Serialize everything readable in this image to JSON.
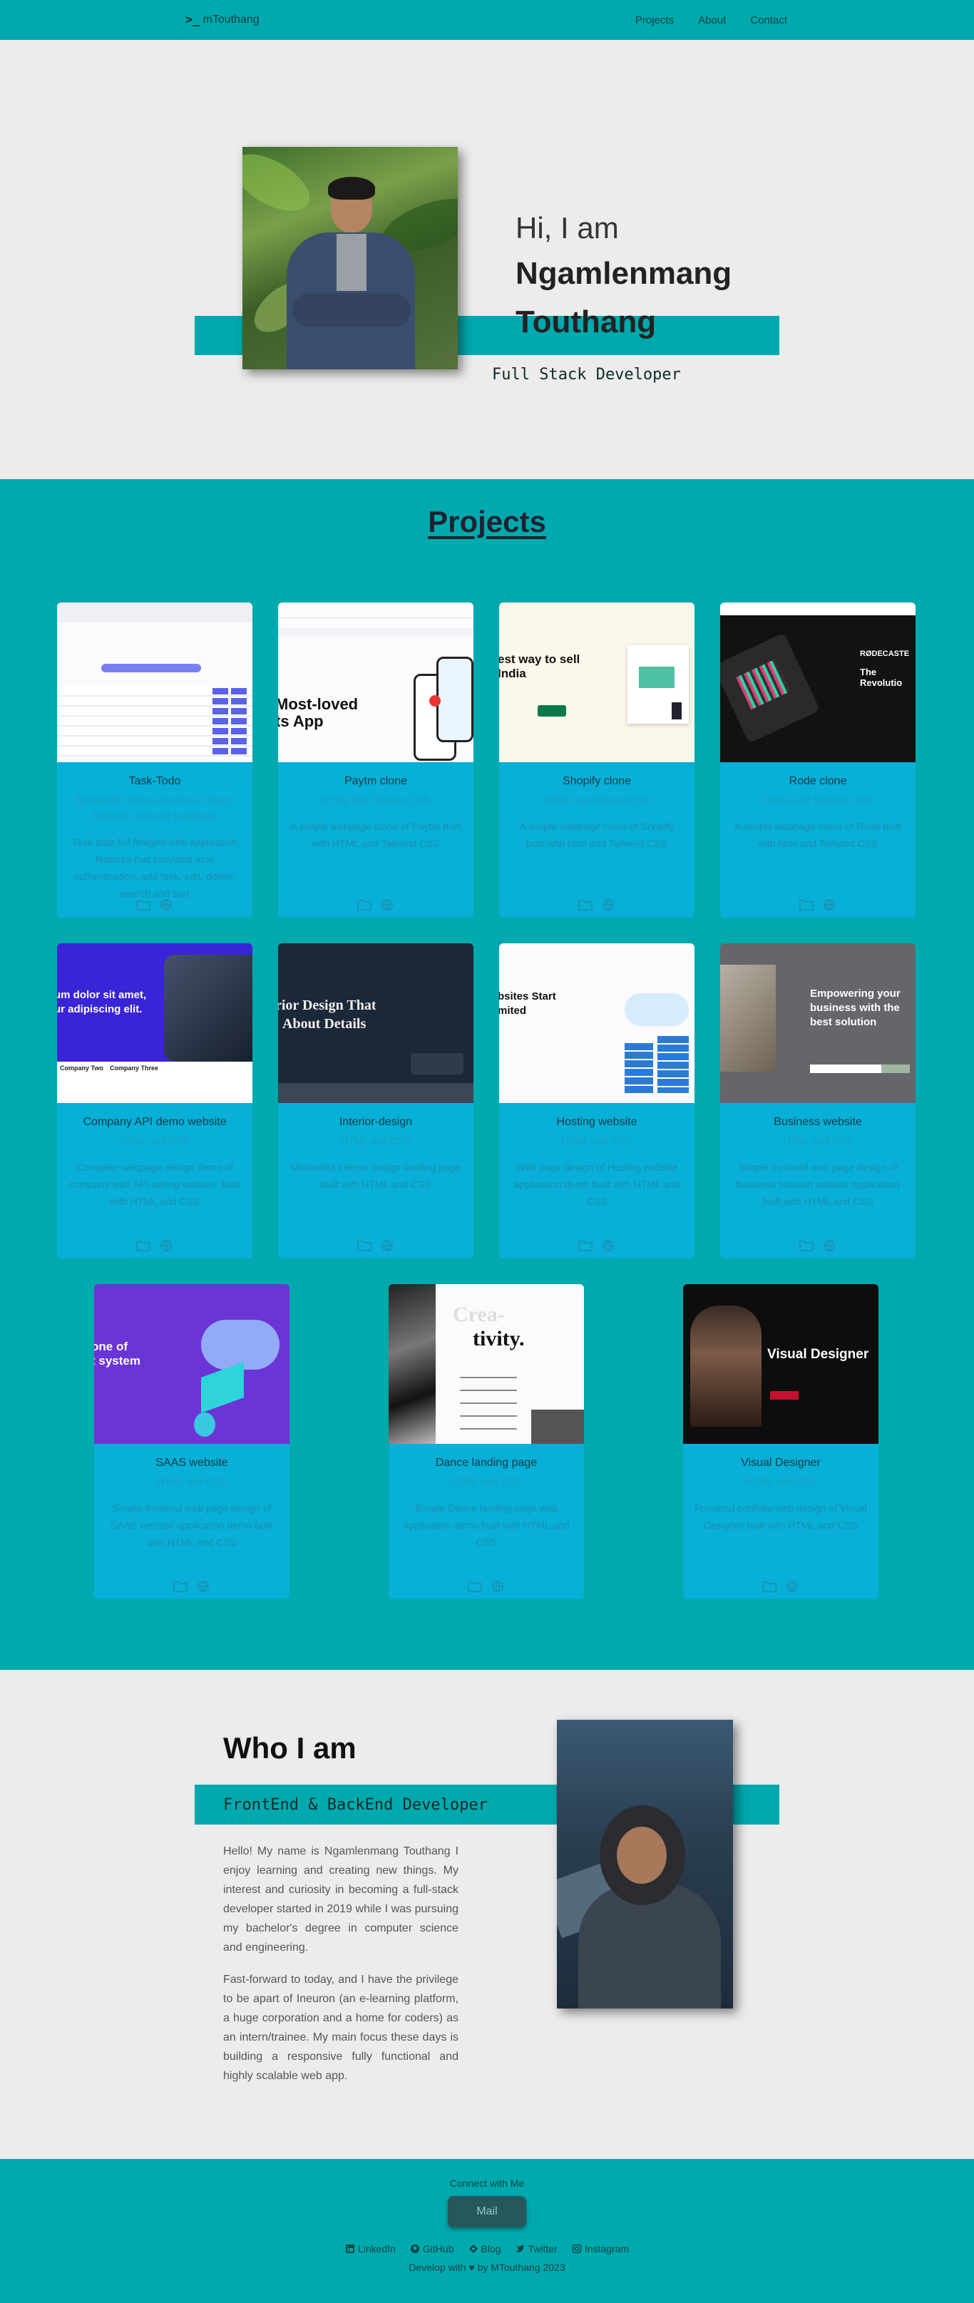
{
  "nav": {
    "brand": "mTouthang",
    "brand_mark": ">_",
    "links": [
      "Projects",
      "About",
      "Contact"
    ]
  },
  "hero": {
    "greeting": "Hi, I am",
    "name_line1": "Ngamlenmang",
    "name_line2": "Touthang",
    "role": "Full Stack Developer"
  },
  "projects": {
    "title": "Projects",
    "cards": [
      {
        "title": "Task-Todo",
        "tech": "MongoDB, Mongo, Express, React, Tailwind CSS and Supabase",
        "desc": "Task todo full fledged web application features that provided user authentication, add task, edit, delete, search and sort",
        "thumb": "task-todo-thumbnail"
      },
      {
        "title": "Paytm clone",
        "tech": "HTML and Tailwind CSS",
        "desc": "A simple webpage clone of Paytm built with HTML and Tailwind CSS",
        "thumb": "paytm-thumbnail"
      },
      {
        "title": "Shopify clone",
        "tech": "HTML and Tailwind CSS",
        "desc": "A simple webpage clone of Shopify built with html and Tailwind CSS",
        "thumb": "shopify-thumbnail"
      },
      {
        "title": "Rode clone",
        "tech": "HTML and Tailwind CSS",
        "desc": "A simple webpage clone of Rode built with html and Tailwind CSS",
        "thumb": "rode-thumbnail"
      },
      {
        "title": "Company API demo website",
        "tech": "HTML and CSS",
        "desc": "Complete webpage design demo of company with API selling website, built with HTML and CSS",
        "thumb": "company-api-thumbnail"
      },
      {
        "title": "Interior-design",
        "tech": "HTML and CSS",
        "desc": "Minimalist Interior design landing page built with HTML and CSS",
        "thumb": "interior-thumbnail"
      },
      {
        "title": "Hosting website",
        "tech": "HTML and CSS",
        "desc": "Web page design of Hosting website application demo built with HTML and CSS",
        "thumb": "hosting-thumbnail"
      },
      {
        "title": "Business website",
        "tech": "HTML and CSS",
        "desc": "Simple frontend web page design of business solution website application built with HTML and CSS",
        "thumb": "business-thumbnail"
      },
      {
        "title": "SAAS website",
        "tech": "HTML and CSS",
        "desc": "Simple frontend web page design of SAAS website application demo built with HTML and CSS",
        "thumb": "saas-thumbnail"
      },
      {
        "title": "Dance landing page",
        "tech": "HTML and CSS",
        "desc": "Simple Dance landing page web application demo built with HTML and CSS",
        "thumb": "dance-thumbnail"
      },
      {
        "title": "Visual Designer",
        "tech": "HTML and CSS",
        "desc": "Frontend portfolio web design of Visual Designer built with HTML and CSS",
        "thumb": "visual-designer-thumbnail"
      }
    ],
    "thumb_text": {
      "paytm_headline_1": "Most-loved",
      "paytm_headline_2": "ts App",
      "shopify_headline_1": "est way to sell",
      "shopify_headline_2": "India",
      "rode_brand": "RØDECASTE",
      "rode_headline": "The Revolutio",
      "company_headline_1": "um dolor sit amet,",
      "company_headline_2": "ur adipiscing elit.",
      "company_footer_1": "Company Two",
      "company_footer_2": "Company Three",
      "interior_headline_1": "rior Design That",
      "interior_headline_2": "About Details",
      "hosting_headline_1": "bsites Start",
      "hosting_headline_2": "mited",
      "business_headline_1": "Empowering your",
      "business_headline_2": "business with the",
      "business_headline_3": "best solution",
      "saas_headline_1": "one of",
      "saas_headline_2": "t system",
      "dance_headline_1": "Crea-",
      "dance_headline_2": "tivity.",
      "visual_headline": "Visual Designer"
    }
  },
  "about": {
    "title": "Who I am",
    "role": "FrontEnd & BackEnd Developer",
    "para1": "Hello! My name is Ngamlenmang Touthang I enjoy learning and creating new things. My interest and curiosity in becoming a full-stack developer started in 2019 while I was pursuing my bachelor's degree in computer science and engineering.",
    "para2": "Fast-forward to today, and I have the privilege to be apart of Ineuron (an e-learning platform, a huge corporation and a home for coders) as an intern/trainee. My main focus these days is building a responsive fully functional and highly scalable web app."
  },
  "footer": {
    "connect": "Connect with Me",
    "mail": "Mail",
    "socials": [
      "LinkedIn",
      "GitHub",
      "Blog",
      "Twitter",
      "Instagram"
    ],
    "credit_prefix": "Develop with",
    "credit_suffix": "by MTouthang 2023"
  },
  "colors": {
    "accent": "#00a9ad",
    "card": "#08afd6",
    "background": "#ececec"
  }
}
